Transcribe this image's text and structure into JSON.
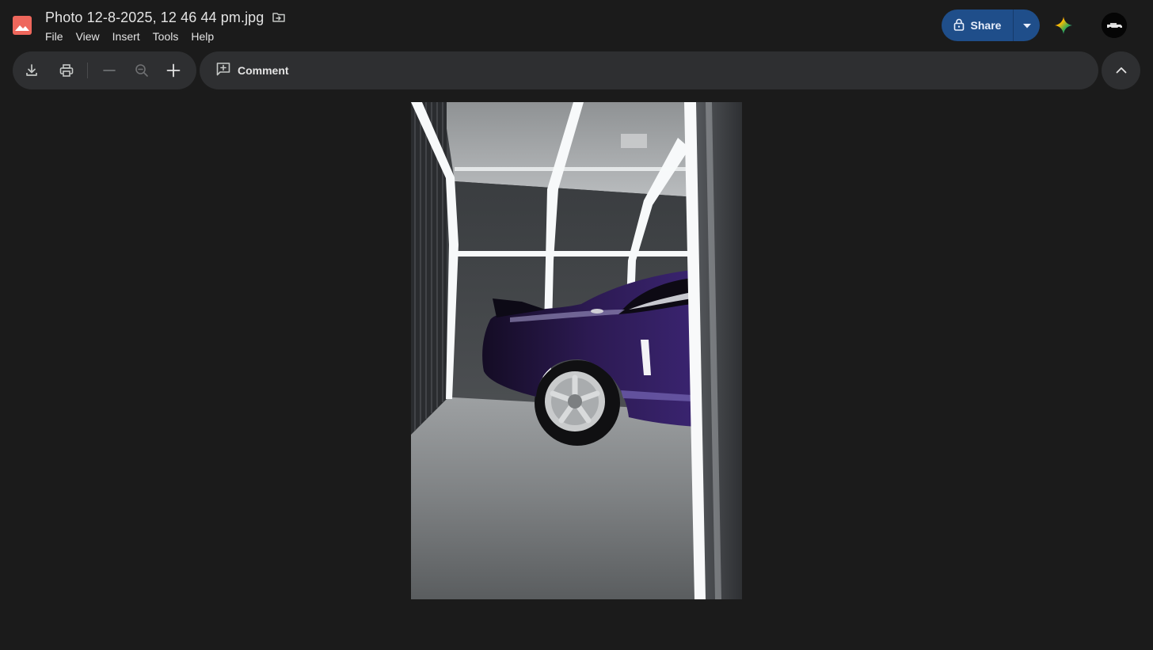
{
  "app": {
    "icon": "image-file-icon",
    "title": "Photo 12-8-2025, 12 46 44 pm.jpg",
    "move_icon": "move-to-folder-icon"
  },
  "menu": [
    "File",
    "View",
    "Insert",
    "Tools",
    "Help"
  ],
  "share": {
    "label": "Share",
    "icon": "lock-icon",
    "dropdown_icon": "caret-down-icon",
    "color": "#1f4e8a"
  },
  "toolbar": {
    "download_icon": "download-icon",
    "print_icon": "print-icon",
    "zoom_out_icon": "minus-icon",
    "zoom_icon": "zoom-out-icon",
    "zoom_in_icon": "plus-icon",
    "comment_label": "Comment",
    "comment_icon": "add-comment-icon",
    "collapse_icon": "chevron-up-icon"
  },
  "colors": {
    "background": "#1b1b1b",
    "toolbar": "#2e2f31",
    "car": "#2a1a4a"
  }
}
